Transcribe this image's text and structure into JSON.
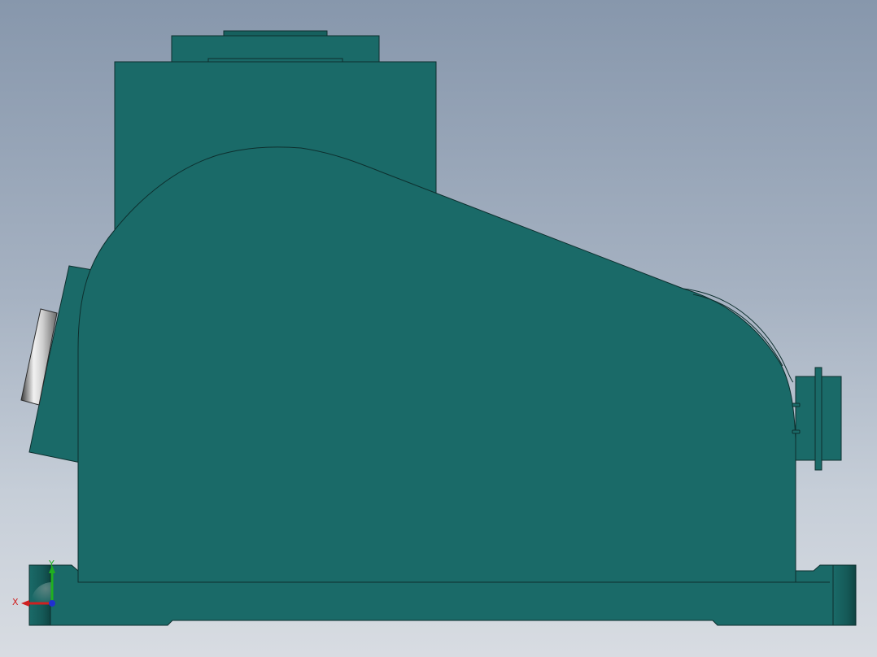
{
  "viewport": {
    "background_top": "#8797ac",
    "background_bottom": "#d8dce2"
  },
  "model": {
    "body_color": "#1a6a68",
    "edge_color": "#0d2f2e",
    "cylinder_highlight": "#e6e6e6",
    "cylinder_shadow": "#3a3a3a"
  },
  "triad": {
    "x_label": "X",
    "y_label": "Y",
    "x_color": "#d02020",
    "y_color": "#20b020",
    "z_color": "#2030d0"
  }
}
